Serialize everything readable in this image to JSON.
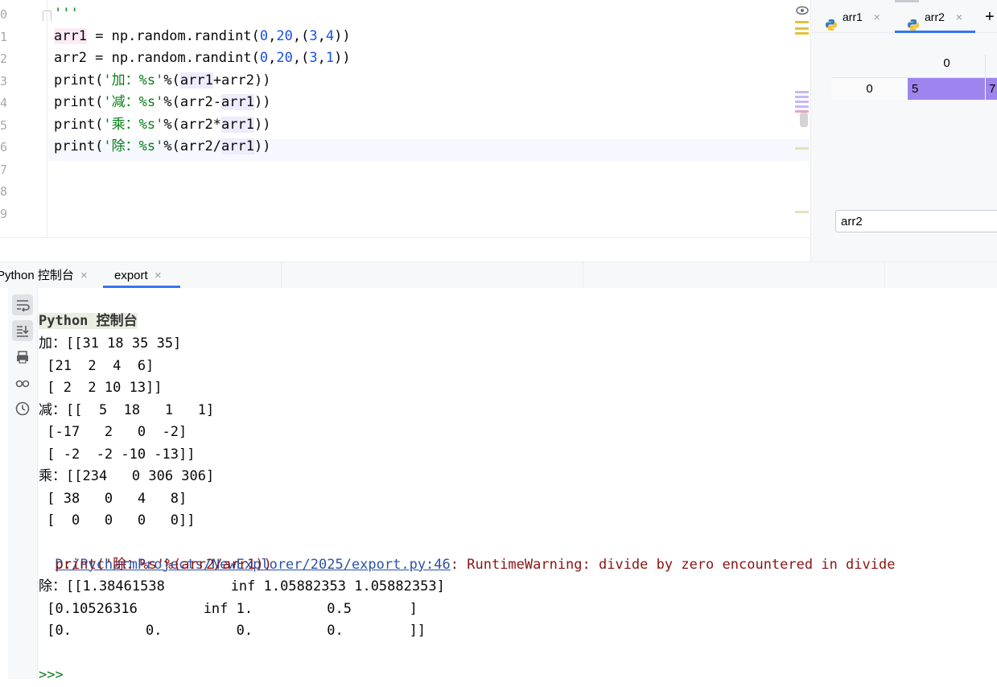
{
  "editor": {
    "line_numbers": [
      "0",
      "1",
      "2",
      "3",
      "4",
      "5",
      "6",
      "7",
      "8",
      "9"
    ],
    "lines": [
      {
        "parts": [
          {
            "t": "'''",
            "c": "str"
          }
        ]
      },
      {
        "parts": [
          {
            "t": "arr1",
            "c": "hl-pink"
          },
          {
            "t": " = np.random.randint(",
            "c": "fn"
          },
          {
            "t": "0",
            "c": "kw-num"
          },
          {
            "t": ",",
            "c": "fn"
          },
          {
            "t": "20",
            "c": "kw-num"
          },
          {
            "t": ",(",
            "c": "fn"
          },
          {
            "t": "3",
            "c": "kw-num"
          },
          {
            "t": ",",
            "c": "fn"
          },
          {
            "t": "4",
            "c": "kw-num"
          },
          {
            "t": "))",
            "c": "fn"
          }
        ]
      },
      {
        "parts": [
          {
            "t": "arr2 = np.random.randint(",
            "c": "fn"
          },
          {
            "t": "0",
            "c": "kw-num"
          },
          {
            "t": ",",
            "c": "fn"
          },
          {
            "t": "20",
            "c": "kw-num"
          },
          {
            "t": ",(",
            "c": "fn"
          },
          {
            "t": "3",
            "c": "kw-num"
          },
          {
            "t": ",",
            "c": "fn"
          },
          {
            "t": "1",
            "c": "kw-num"
          },
          {
            "t": "))",
            "c": "fn"
          }
        ]
      },
      {
        "parts": [
          {
            "t": "print(",
            "c": "fn"
          },
          {
            "t": "'加：%s'",
            "c": "str"
          },
          {
            "t": "%(",
            "c": "fn"
          },
          {
            "t": "arr1",
            "c": "hl"
          },
          {
            "t": "+arr2))",
            "c": "fn"
          }
        ]
      },
      {
        "parts": [
          {
            "t": "print(",
            "c": "fn"
          },
          {
            "t": "'减：%s'",
            "c": "str"
          },
          {
            "t": "%(arr2-",
            "c": "fn"
          },
          {
            "t": "arr1",
            "c": "hl"
          },
          {
            "t": "))",
            "c": "fn"
          }
        ]
      },
      {
        "parts": [
          {
            "t": "print(",
            "c": "fn"
          },
          {
            "t": "'乘：%s'",
            "c": "str"
          },
          {
            "t": "%(arr2*",
            "c": "fn"
          },
          {
            "t": "arr1",
            "c": "hl"
          },
          {
            "t": "))",
            "c": "fn"
          }
        ]
      },
      {
        "parts": [
          {
            "t": "print(",
            "c": "fn"
          },
          {
            "t": "'除：%s'",
            "c": "str"
          },
          {
            "t": "%(arr2/",
            "c": "fn"
          },
          {
            "t": "arr1",
            "c": "hl"
          },
          {
            "t": "))",
            "c": "fn"
          }
        ]
      }
    ]
  },
  "var_panel": {
    "tabs": [
      {
        "label": "arr1"
      },
      {
        "label": "arr2"
      }
    ],
    "add_label": "+",
    "close_glyph": "×",
    "column_header": "0",
    "row_index": "0",
    "cells": [
      "5",
      "7"
    ],
    "input_value": "arr2",
    "colors": {
      "cell": "#9e84ee",
      "active_tab_underline": "#3574f0"
    }
  },
  "tool_tabs": [
    {
      "label": "Python 控制台"
    },
    {
      "label": "export"
    }
  ],
  "console": {
    "banner": "Python 控制台",
    "lines": [
      {
        "t": "加：[[31 18 35 35]"
      },
      {
        "t": " [21  2  4  6]"
      },
      {
        "t": " [ 2  2 10 13]]"
      },
      {
        "t": "减：[[  5  18   1   1]"
      },
      {
        "t": " [-17   2   0  -2]"
      },
      {
        "t": " [ -2  -2 -10 -13]]"
      },
      {
        "t": "乘：[[234   0 306 306]"
      },
      {
        "t": " [ 38   0   4   8]"
      },
      {
        "t": " [  0   0   0   0]]"
      }
    ],
    "warning_link": "D:/PycharmProjects/NewExplorer/2025/export.py:46",
    "warning_text": ": RuntimeWarning: divide by zero encountered in divide",
    "warning_code": "  print('除：%s'%(arr2/arr1))",
    "div_lines": [
      {
        "t": "除：[[1.38461538        inf 1.05882353 1.05882353]"
      },
      {
        "t": " [0.10526316        inf 1.         0.5       ]"
      },
      {
        "t": " [0.         0.         0.         0.        ]]"
      }
    ],
    "prompt": ">>>"
  }
}
